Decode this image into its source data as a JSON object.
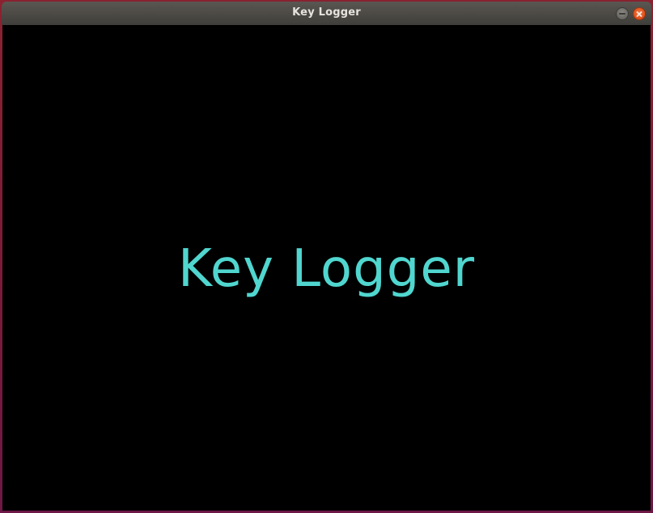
{
  "window": {
    "title": "Key Logger"
  },
  "main": {
    "heading": "Key Logger",
    "heading_color": "#50d6cf",
    "background_color": "#000000"
  },
  "titlebar": {
    "minimize_icon": "minimize-icon",
    "close_icon": "close-icon",
    "close_color": "#e95420"
  }
}
